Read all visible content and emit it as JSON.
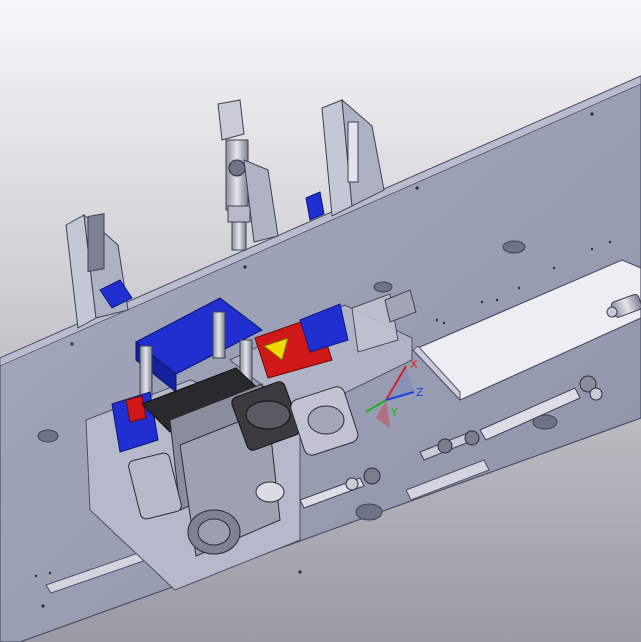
{
  "viewport": {
    "background_top": "#f7f7f9",
    "background_bottom": "#9a9aa4"
  },
  "colors": {
    "plate": "#9da2b8",
    "plate_edge": "#5a5e70",
    "plate_dark": "#7c8096",
    "metal": "#c9ccd6",
    "metal_dark": "#6e7280",
    "blue_part": "#1f2fd0",
    "red_part": "#d01818",
    "yellow_part": "#f0d800",
    "gear_black": "#2a2a2e",
    "axis_x": "#e02020",
    "axis_y": "#20b020",
    "axis_z": "#2040e0"
  },
  "triad": {
    "x_label": "X",
    "y_label": "Y",
    "z_label": "Z"
  },
  "icons": [
    "coordinate-triad-icon"
  ]
}
